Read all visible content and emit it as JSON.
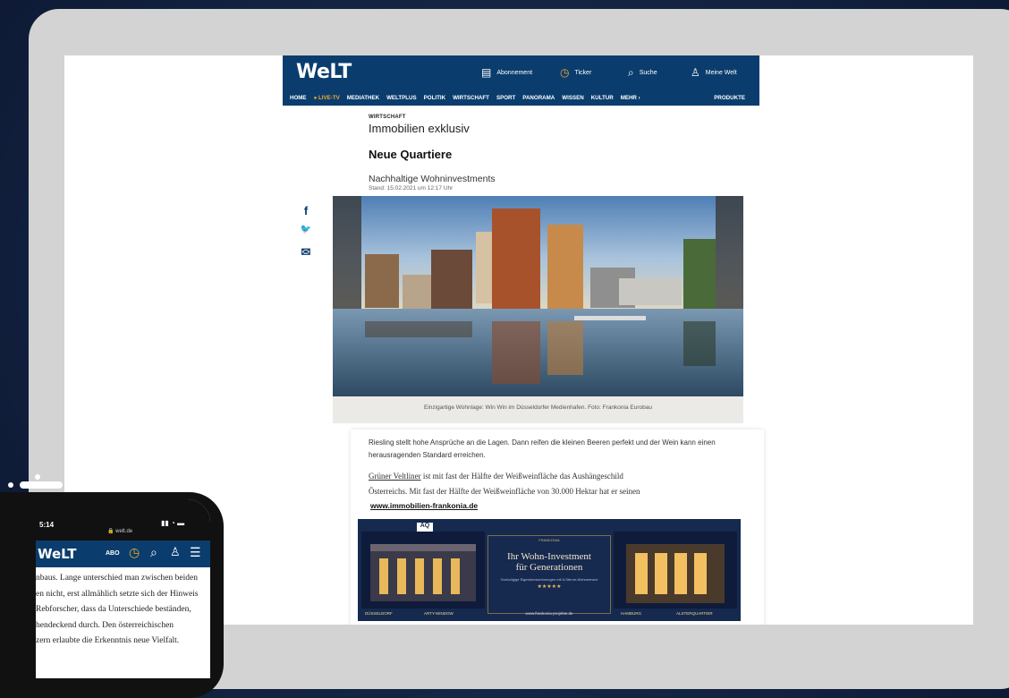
{
  "site": {
    "logo": "WeLT",
    "nav_util": [
      {
        "icon": "newspaper-icon",
        "glyph": "▤",
        "label": "Abonnement"
      },
      {
        "icon": "ticker-icon",
        "glyph": "◷",
        "label": "Ticker"
      },
      {
        "icon": "search-icon",
        "glyph": "⌕",
        "label": "Suche"
      },
      {
        "icon": "user-icon",
        "glyph": "♙",
        "label": "Meine Welt"
      }
    ],
    "nav": [
      "HOME",
      "● LIVE-TV",
      "MEDIATHEK",
      "WELTPLUS",
      "POLITIK",
      "WIRTSCHAFT",
      "SPORT",
      "PANORAMA",
      "WISSEN",
      "KULTUR",
      "MEHR ›"
    ],
    "nav_products": "PRODUKTE"
  },
  "article": {
    "kicker": "WIRTSCHAFT",
    "line1": "Immobilien exklusiv",
    "headline": "Neue Quartiere",
    "subhead": "Nachhaltige Wohninvestments",
    "date": "Stand: 15.02.2021 um 12:17 Uhr",
    "caption": "Einzigartige Wohnlage: Win Win im Düsseldorfer Medienhafen. Foto: Frankonia Eurobau",
    "p1": "Riesling stellt hohe Ansprüche an die Lagen. Dann reifen die kleinen Beeren perfekt und der Wein kann einen herausragenden Standard erreichen.",
    "p2_link": "Grüner Veltliner",
    "p2_rest": " ist mit fast der Hälfte der Weißweinfläche das Aushängeschild",
    "p2_line2": "Österreichs. Mit fast der Hälfte der Weißweinfläche von 30.000 Hektar hat er seinen",
    "ad_url": "www.immobilien-frankonia.de"
  },
  "ad": {
    "brand_top": "FRANKONIA",
    "title_line1": "Ihr Wohn-Investment",
    "title_line2": "für Generationen",
    "subtitle": "Großzügige Eigentumswohnungen mit 5-Sterne-Wohnservice",
    "stars": "★★★★★",
    "logo_badge": "AQ",
    "left_tag1": "DÜSSELDORF",
    "left_tag2": "ARTY-WINDOW",
    "right_tag1": "HAMBURG",
    "right_tag2": "ALSTERQUARTIER",
    "footer": "www.frankonia-projekte.de"
  },
  "social": [
    {
      "icon": "facebook-icon",
      "glyph": "f"
    },
    {
      "icon": "twitter-icon",
      "glyph": "🐦"
    },
    {
      "icon": "mail-icon",
      "glyph": "✉"
    }
  ],
  "phone": {
    "time": "5:14",
    "url": "🔒 welt.de",
    "logo": "WeLT",
    "abo": "ABO",
    "lines": [
      "nbaus. Lange unterschied man zwischen beiden",
      "en nicht, erst allmählich setzte sich der Hinweis",
      "Rebforscher, dass da Unterschiede beständen,",
      "hendeckend durch. Den österreichischen",
      "zern erlaubte die Erkenntnis neue Vielfalt."
    ]
  },
  "colors": {
    "brand": "#0a3d6e",
    "live": "#f7a92b",
    "ad_bg": "#16294f"
  }
}
